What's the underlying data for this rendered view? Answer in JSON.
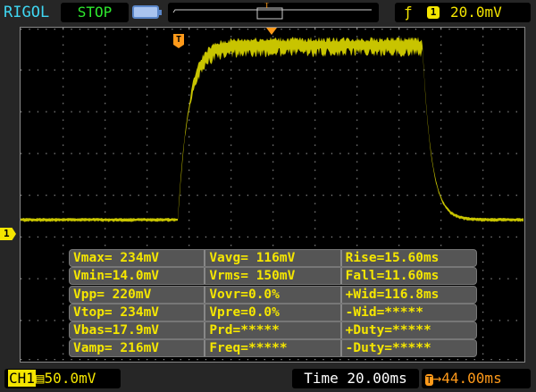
{
  "header": {
    "brand": "RIGOL",
    "run_state": "STOP",
    "trigger_edge_icon": "rising-edge",
    "trigger_channel": "1",
    "trigger_level": "20.0mV",
    "memory_marker": "T"
  },
  "screen": {
    "trigger_marker": "T",
    "channel_marker": "1"
  },
  "measurements": [
    [
      "Vmax= 234mV",
      "Vavg= 116mV",
      "Rise=15.60ms"
    ],
    [
      "Vmin=14.0mV",
      "Vrms= 150mV",
      "Fall=11.60ms"
    ],
    [
      "Vpp= 220mV",
      "Vovr=0.0%",
      "+Wid=116.8ms"
    ],
    [
      "Vtop= 234mV",
      "Vpre=0.0%",
      "-Wid=*****"
    ],
    [
      "Vbas=17.9mV",
      "Prd=*****",
      "+Duty=*****"
    ],
    [
      "Vamp= 216mV",
      "Freq=*****",
      "-Duty=*****"
    ]
  ],
  "footer": {
    "channel": "CH1",
    "coupling_icon": "dc-coupling",
    "volts_div": "50.0mV",
    "time_label": "Time",
    "time_div": "20.00ms",
    "trigger_offset": "44.00ms",
    "trigger_offset_icon": "T"
  },
  "colors": {
    "trace": "#c8c400",
    "accent": "#f5e600",
    "trigger": "#ff9a1a"
  }
}
